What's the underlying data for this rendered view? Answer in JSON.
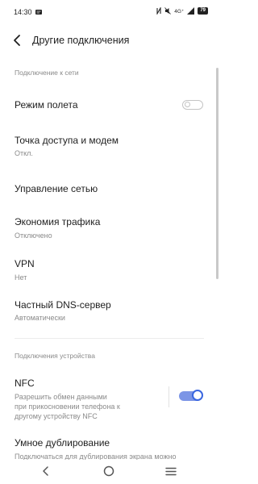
{
  "status_bar": {
    "time": "14:30",
    "network": "4G⁺",
    "battery": "79",
    "icons": [
      "message-icon",
      "nfc-icon",
      "mute-icon",
      "signal-icon",
      "battery-icon"
    ]
  },
  "header": {
    "title": "Другие подключения",
    "back_icon": "arrow-left-icon"
  },
  "sections": [
    {
      "label": "Подключение к сети",
      "items": [
        {
          "title": "Режим полета",
          "toggle": false
        },
        {
          "title": "Точка доступа и модем",
          "subtitle": "Откл."
        },
        {
          "title": "Управление сетью"
        },
        {
          "title": "Экономия трафика",
          "subtitle": "Отключено"
        },
        {
          "title": "VPN",
          "subtitle": "Нет"
        },
        {
          "title": "Частный DNS-сервер",
          "subtitle": "Автоматически"
        }
      ]
    },
    {
      "label": "Подключения устройства",
      "items": [
        {
          "title": "NFC",
          "subtitle": "Разрешить обмен данными при прикосновении телефона к другому устройству NFC",
          "subtitle_lines": [
            "Разрешить обмен данными",
            "при прикосновении телефона к",
            "другому устройству NFC"
          ],
          "toggle": true
        },
        {
          "title": "Умное дублирование",
          "subtitle": "Подключаться для дублирования экрана можно"
        }
      ]
    }
  ],
  "nav_bar": {
    "icons": [
      "nav-back-icon",
      "nav-home-icon",
      "nav-menu-icon"
    ]
  },
  "colors": {
    "accent": "#3a67e0",
    "toggle_track_on": "#7c95e6",
    "secondary_text": "#8a8a8a"
  }
}
